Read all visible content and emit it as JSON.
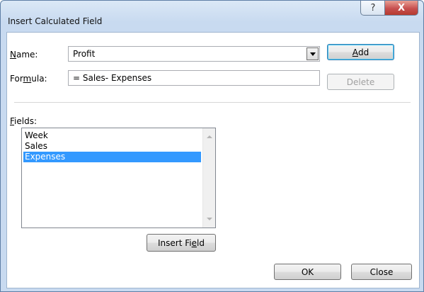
{
  "window": {
    "title": "Insert Calculated Field",
    "help_label": "?",
    "close_label": "X"
  },
  "name": {
    "label_pre": "",
    "label_key": "N",
    "label_post": "ame:",
    "value": "Profit"
  },
  "formula": {
    "label_pre": "For",
    "label_key": "m",
    "label_post": "ula:",
    "value": "= Sales- Expenses"
  },
  "buttons": {
    "add_key": "A",
    "add_post": "dd",
    "delete_label": "Delete",
    "insert_pre": "Insert Fi",
    "insert_key": "e",
    "insert_post": "ld",
    "ok_label": "OK",
    "close_label": "Close"
  },
  "fields": {
    "label_key": "F",
    "label_post": "ields:",
    "items": [
      "Week",
      "Sales",
      "Expenses"
    ],
    "selected_index": 2
  }
}
